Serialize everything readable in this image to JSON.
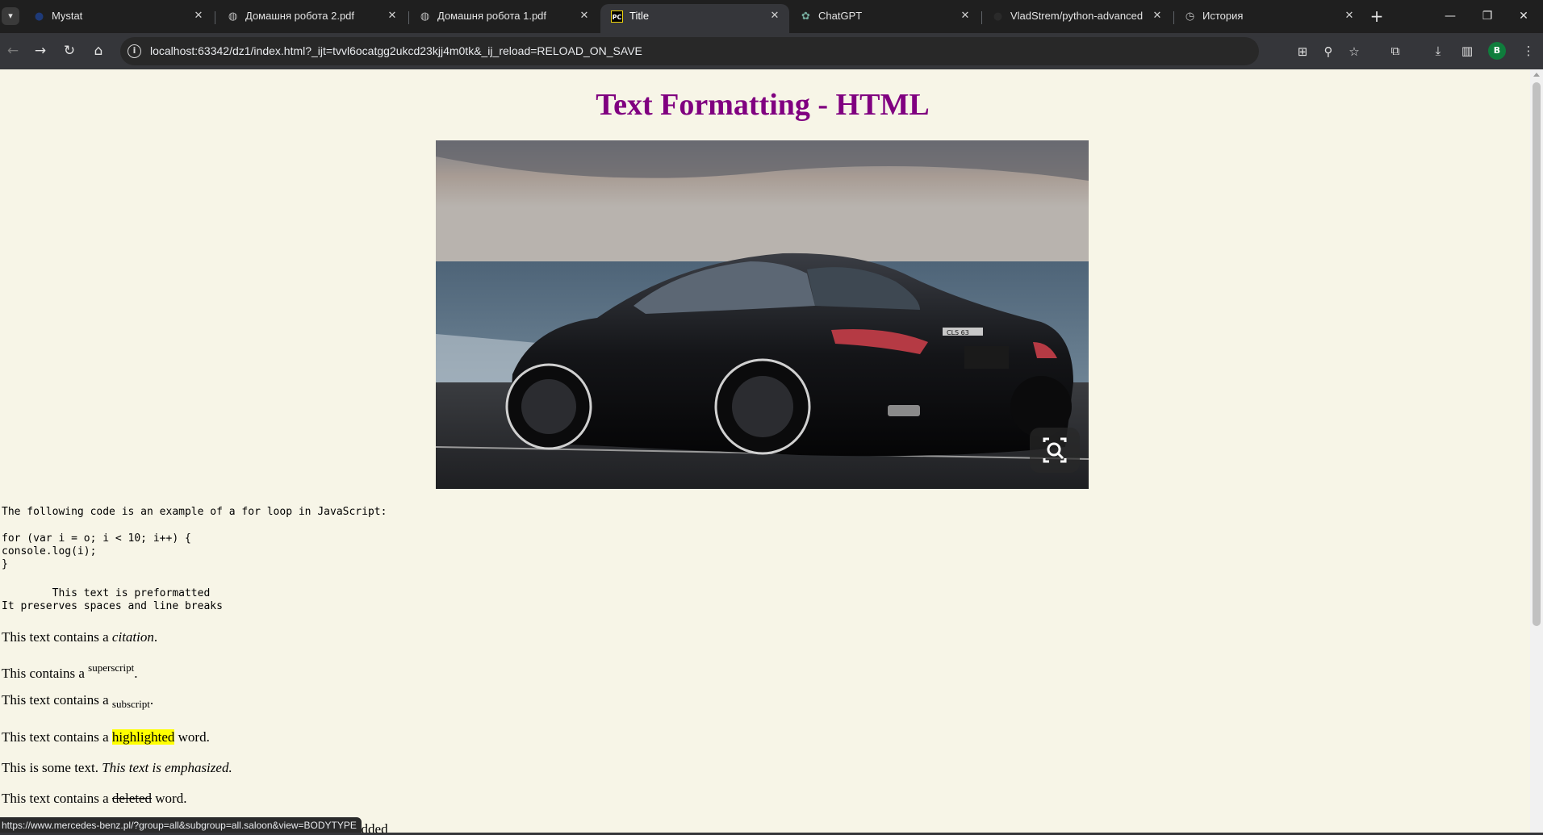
{
  "browser": {
    "tabs": [
      {
        "title": "Mystat",
        "icon": "mystat-logo-icon",
        "active": false
      },
      {
        "title": "Домашня робота 2.pdf",
        "icon": "globe-icon",
        "active": false
      },
      {
        "title": "Домашня робота 1.pdf",
        "icon": "globe-icon",
        "active": false
      },
      {
        "title": "Title",
        "icon": "pycharm-icon",
        "active": true
      },
      {
        "title": "ChatGPT",
        "icon": "chatgpt-icon",
        "active": false
      },
      {
        "title": "VladStrem/python-advanced",
        "icon": "github-icon",
        "active": false
      },
      {
        "title": "История",
        "icon": "history-icon",
        "active": false
      }
    ],
    "tab_close_glyph": "✕",
    "new_tab_glyph": "+",
    "url": "localhost:63342/dz1/index.html?_ijt=tvvl6ocatgg2ukcd23kjj4m0tk&_ij_reload=RELOAD_ON_SAVE",
    "profile_initial": "B",
    "status_url": "https://www.mercedes-benz.pl/?group=all&subgroup=all.saloon&view=BODYTYPE"
  },
  "page": {
    "title": "Text Formatting - HTML",
    "image_alt": "Mercedes-Benz CLS 63 rear three-quarter view by the sea",
    "car_badge": "CLS 63",
    "code_intro": "The following code is an example of a for loop in JavaScript:",
    "code_block": "for (var i = o; i < 10; i++) {\nconsole.log(i);\n}",
    "pre_text": "        This text is preformatted\nIt preserves spaces and line breaks",
    "citation": {
      "before": "This text contains a ",
      "em": "citation",
      "after": "."
    },
    "superscript": {
      "before": "This contains a ",
      "sup": "superscript",
      "after": "."
    },
    "subscript": {
      "before": "This text contains a ",
      "sub": "subscript",
      "after": "."
    },
    "highlight": {
      "before": "This text contains a ",
      "mark": "highlighted",
      "after": " word."
    },
    "emphasis": {
      "before": "This is some text. ",
      "em": "This text is emphasized."
    },
    "deleted": {
      "before": "This text contains a ",
      "del": "deleted",
      "after": " word."
    },
    "added_partial": "added"
  },
  "colors": {
    "page_bg": "#f7f5e7",
    "title": "#800080",
    "highlight": "#ffff00"
  }
}
